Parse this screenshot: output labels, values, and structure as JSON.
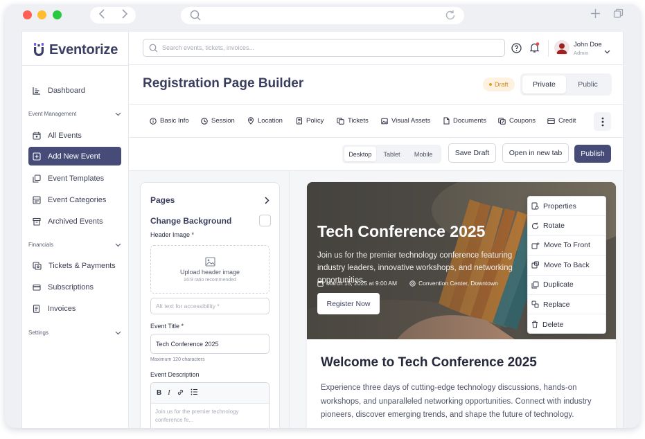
{
  "app": {
    "name": "Eventorize"
  },
  "search": {
    "placeholder": "Search events, tickets, invoices..."
  },
  "user": {
    "name": "John Doe",
    "role": "Admin"
  },
  "sidebar": {
    "dashboard": "Dashboard",
    "section_event": "Event Management",
    "all_events": "All Events",
    "add_new_event": "Add New Event",
    "event_templates": "Event Templates",
    "event_categories": "Event Categories",
    "archived_events": "Archived Events",
    "section_financials": "Financials",
    "tickets_payments": "Tickets & Payments",
    "subscriptions": "Subscriptions",
    "invoices": "Invoices",
    "section_settings": "Settings"
  },
  "header": {
    "title": "Registration Page Builder",
    "status": "Draft",
    "visibility": [
      "Private",
      "Public"
    ]
  },
  "tabs": [
    "Basic Info",
    "Session",
    "Location",
    "Policy",
    "Tickets",
    "Visual Assets",
    "Documents",
    "Coupons",
    "Credit"
  ],
  "toolbar": {
    "devices": [
      "Desktop",
      "Tablet",
      "Mobile"
    ],
    "save_draft": "Save Draft",
    "open_new_tab": "Open in new tab",
    "publish": "Publish"
  },
  "editor": {
    "pages": "Pages",
    "change_background": "Change Background",
    "header_image_label": "Header Image *",
    "upload_text": "Upload header image",
    "upload_hint": "16:9 ratio recommended",
    "alt_placeholder": "Alt text for accessibility *",
    "event_title_label": "Event Title *",
    "event_title_value": "Tech Conference 2025",
    "title_hint": "Maximum 120 characters",
    "description_label": "Event Description",
    "description_text": "Join us for the premier technology conference fe..."
  },
  "preview": {
    "hero_title": "Tech Conference 2025",
    "hero_desc": "Join us for the premier technology conference featuring industry leaders, innovative workshops, and networking opportunities.",
    "date": "March 15, 2025 at 9:00 AM",
    "location": "Convention Center, Downtown",
    "register": "Register Now",
    "welcome": "Welcome to Tech Conference 2025",
    "body": "Experience three days of cutting-edge technology discussions, hands-on workshops, and unparalleled networking opportunities. Connect with industry pioneers, discover emerging trends, and shape the future of technology."
  },
  "context_menu": [
    "Properties",
    "Rotate",
    "Move To Front",
    "Move To Back",
    "Duplicate",
    "Replace",
    "Delete"
  ],
  "colors": {
    "primary": "#474b78",
    "draft": "#d58a26",
    "notification": "#e5484d"
  }
}
